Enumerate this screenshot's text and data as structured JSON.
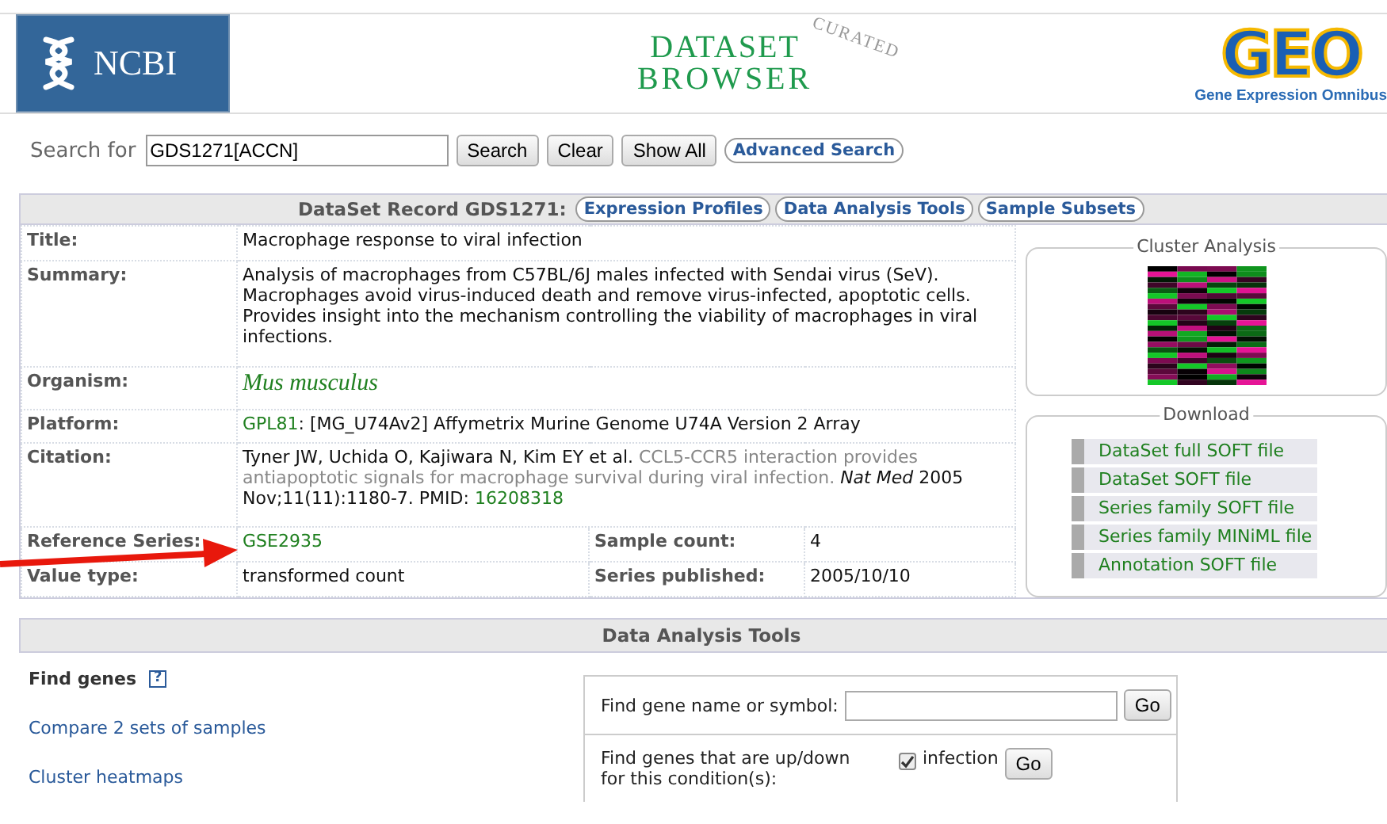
{
  "header": {
    "ncbi_logo": "NCBI",
    "browser_logo": {
      "line_1": "DATASET",
      "line_2": "BROWSER",
      "stamp": "CURATED"
    },
    "geo_logo": {
      "mark": "GEO",
      "caption": "Gene Expression Omnibus"
    }
  },
  "search": {
    "label": "Search for",
    "value": "GDS1271[ACCN]",
    "buttons": [
      "Search",
      "Clear",
      "Show All"
    ],
    "advanced": "Advanced Search"
  },
  "record": {
    "heading": "DataSet Record GDS1271:",
    "tabs": [
      "Expression Profiles",
      "Data Analysis Tools",
      "Sample Subsets"
    ],
    "title": {
      "label": "Title:",
      "value": "Macrophage response to viral infection"
    },
    "summary": {
      "label": "Summary:",
      "value": "Analysis of macrophages from C57BL/6J males infected with Sendai virus (SeV). Macrophages avoid virus-induced death and remove virus-infected, apoptotic cells. Provides insight into the mechanism controlling the viability of macrophages in viral infections."
    },
    "organism": {
      "label": "Organism:",
      "value": "Mus musculus"
    },
    "platform": {
      "label": "Platform:",
      "link": "GPL81",
      "rest": ": [MG_U74Av2] Affymetrix Murine Genome U74A Version 2 Array"
    },
    "citation": {
      "label": "Citation:",
      "authors": "Tyner JW, Uchida O, Kajiwara N, Kim EY et al.",
      "article": "CCL5-CCR5 interaction provides antiapoptotic signals for macrophage survival during viral infection.",
      "journal": "Nat Med",
      "details": "2005 Nov;11(11):1180-7. PMID:",
      "pmid": "16208318"
    },
    "reference_series": {
      "label": "Reference Series:",
      "value": "GSE2935"
    },
    "sample_count": {
      "label": "Sample count:",
      "value": "4"
    },
    "value_type": {
      "label": "Value type:",
      "value": "transformed count"
    },
    "series_published": {
      "label": "Series published:",
      "value": "2005/10/10"
    },
    "cluster_analysis": {
      "legend": "Cluster Analysis"
    },
    "download": {
      "legend": "Download",
      "files": [
        "DataSet full SOFT file",
        "DataSet SOFT file",
        "Series family SOFT file",
        "Series family MINiML file",
        "Annotation SOFT file"
      ]
    }
  },
  "analysis_tools": {
    "heading": "Data Analysis Tools",
    "find_genes": "Find genes",
    "help": "?",
    "links": [
      "Compare 2 sets of samples",
      "Cluster heatmaps"
    ],
    "gene_search": {
      "label": "Find gene name or symbol:",
      "button": "Go"
    },
    "condition": {
      "label": "Find genes that are up/down for this condition(s):",
      "option": "infection",
      "checked": true,
      "button": "Go"
    }
  }
}
